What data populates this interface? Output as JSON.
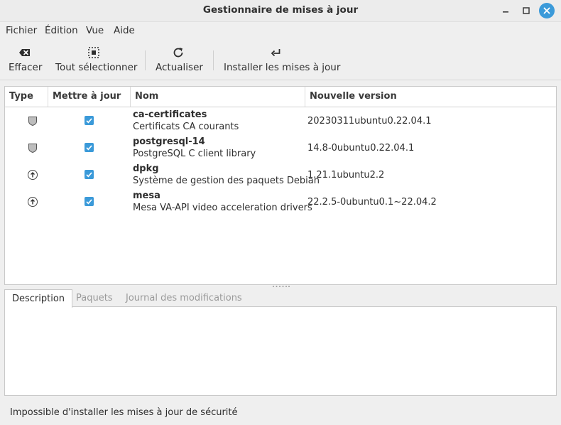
{
  "window": {
    "title": "Gestionnaire de mises à jour",
    "close_color": "#3b9ad9"
  },
  "menu": [
    "Fichier",
    "Édition",
    "Vue",
    "Aide"
  ],
  "toolbar": {
    "clear_label": "Effacer",
    "select_all_label": "Tout sélectionner",
    "refresh_label": "Actualiser",
    "install_label": "Installer les mises à jour"
  },
  "table": {
    "columns": [
      "Type",
      "Mettre à jour",
      "Nom",
      "Nouvelle version"
    ],
    "rows": [
      {
        "type": "security-shield-icon",
        "checked": true,
        "name": "ca-certificates",
        "description": "Certificats CA courants",
        "version": "20230311ubuntu0.22.04.1"
      },
      {
        "type": "security-shield-icon",
        "checked": true,
        "name": "postgresql-14",
        "description": "PostgreSQL C client library",
        "version": "14.8-0ubuntu0.22.04.1"
      },
      {
        "type": "upgrade-arrow-icon",
        "checked": true,
        "name": "dpkg",
        "description": "Système de gestion des paquets Debian",
        "version": "1.21.1ubuntu2.2"
      },
      {
        "type": "upgrade-arrow-icon",
        "checked": true,
        "name": "mesa",
        "description": "Mesa VA-API video acceleration drivers",
        "version": "22.2.5-0ubuntu0.1~22.04.2"
      }
    ]
  },
  "tabs": [
    "Description",
    "Paquets",
    "Journal des modifications"
  ],
  "active_tab": "Description",
  "status": "Impossible d'installer les mises à jour de sécurité",
  "accent_color": "#3b9ad9"
}
